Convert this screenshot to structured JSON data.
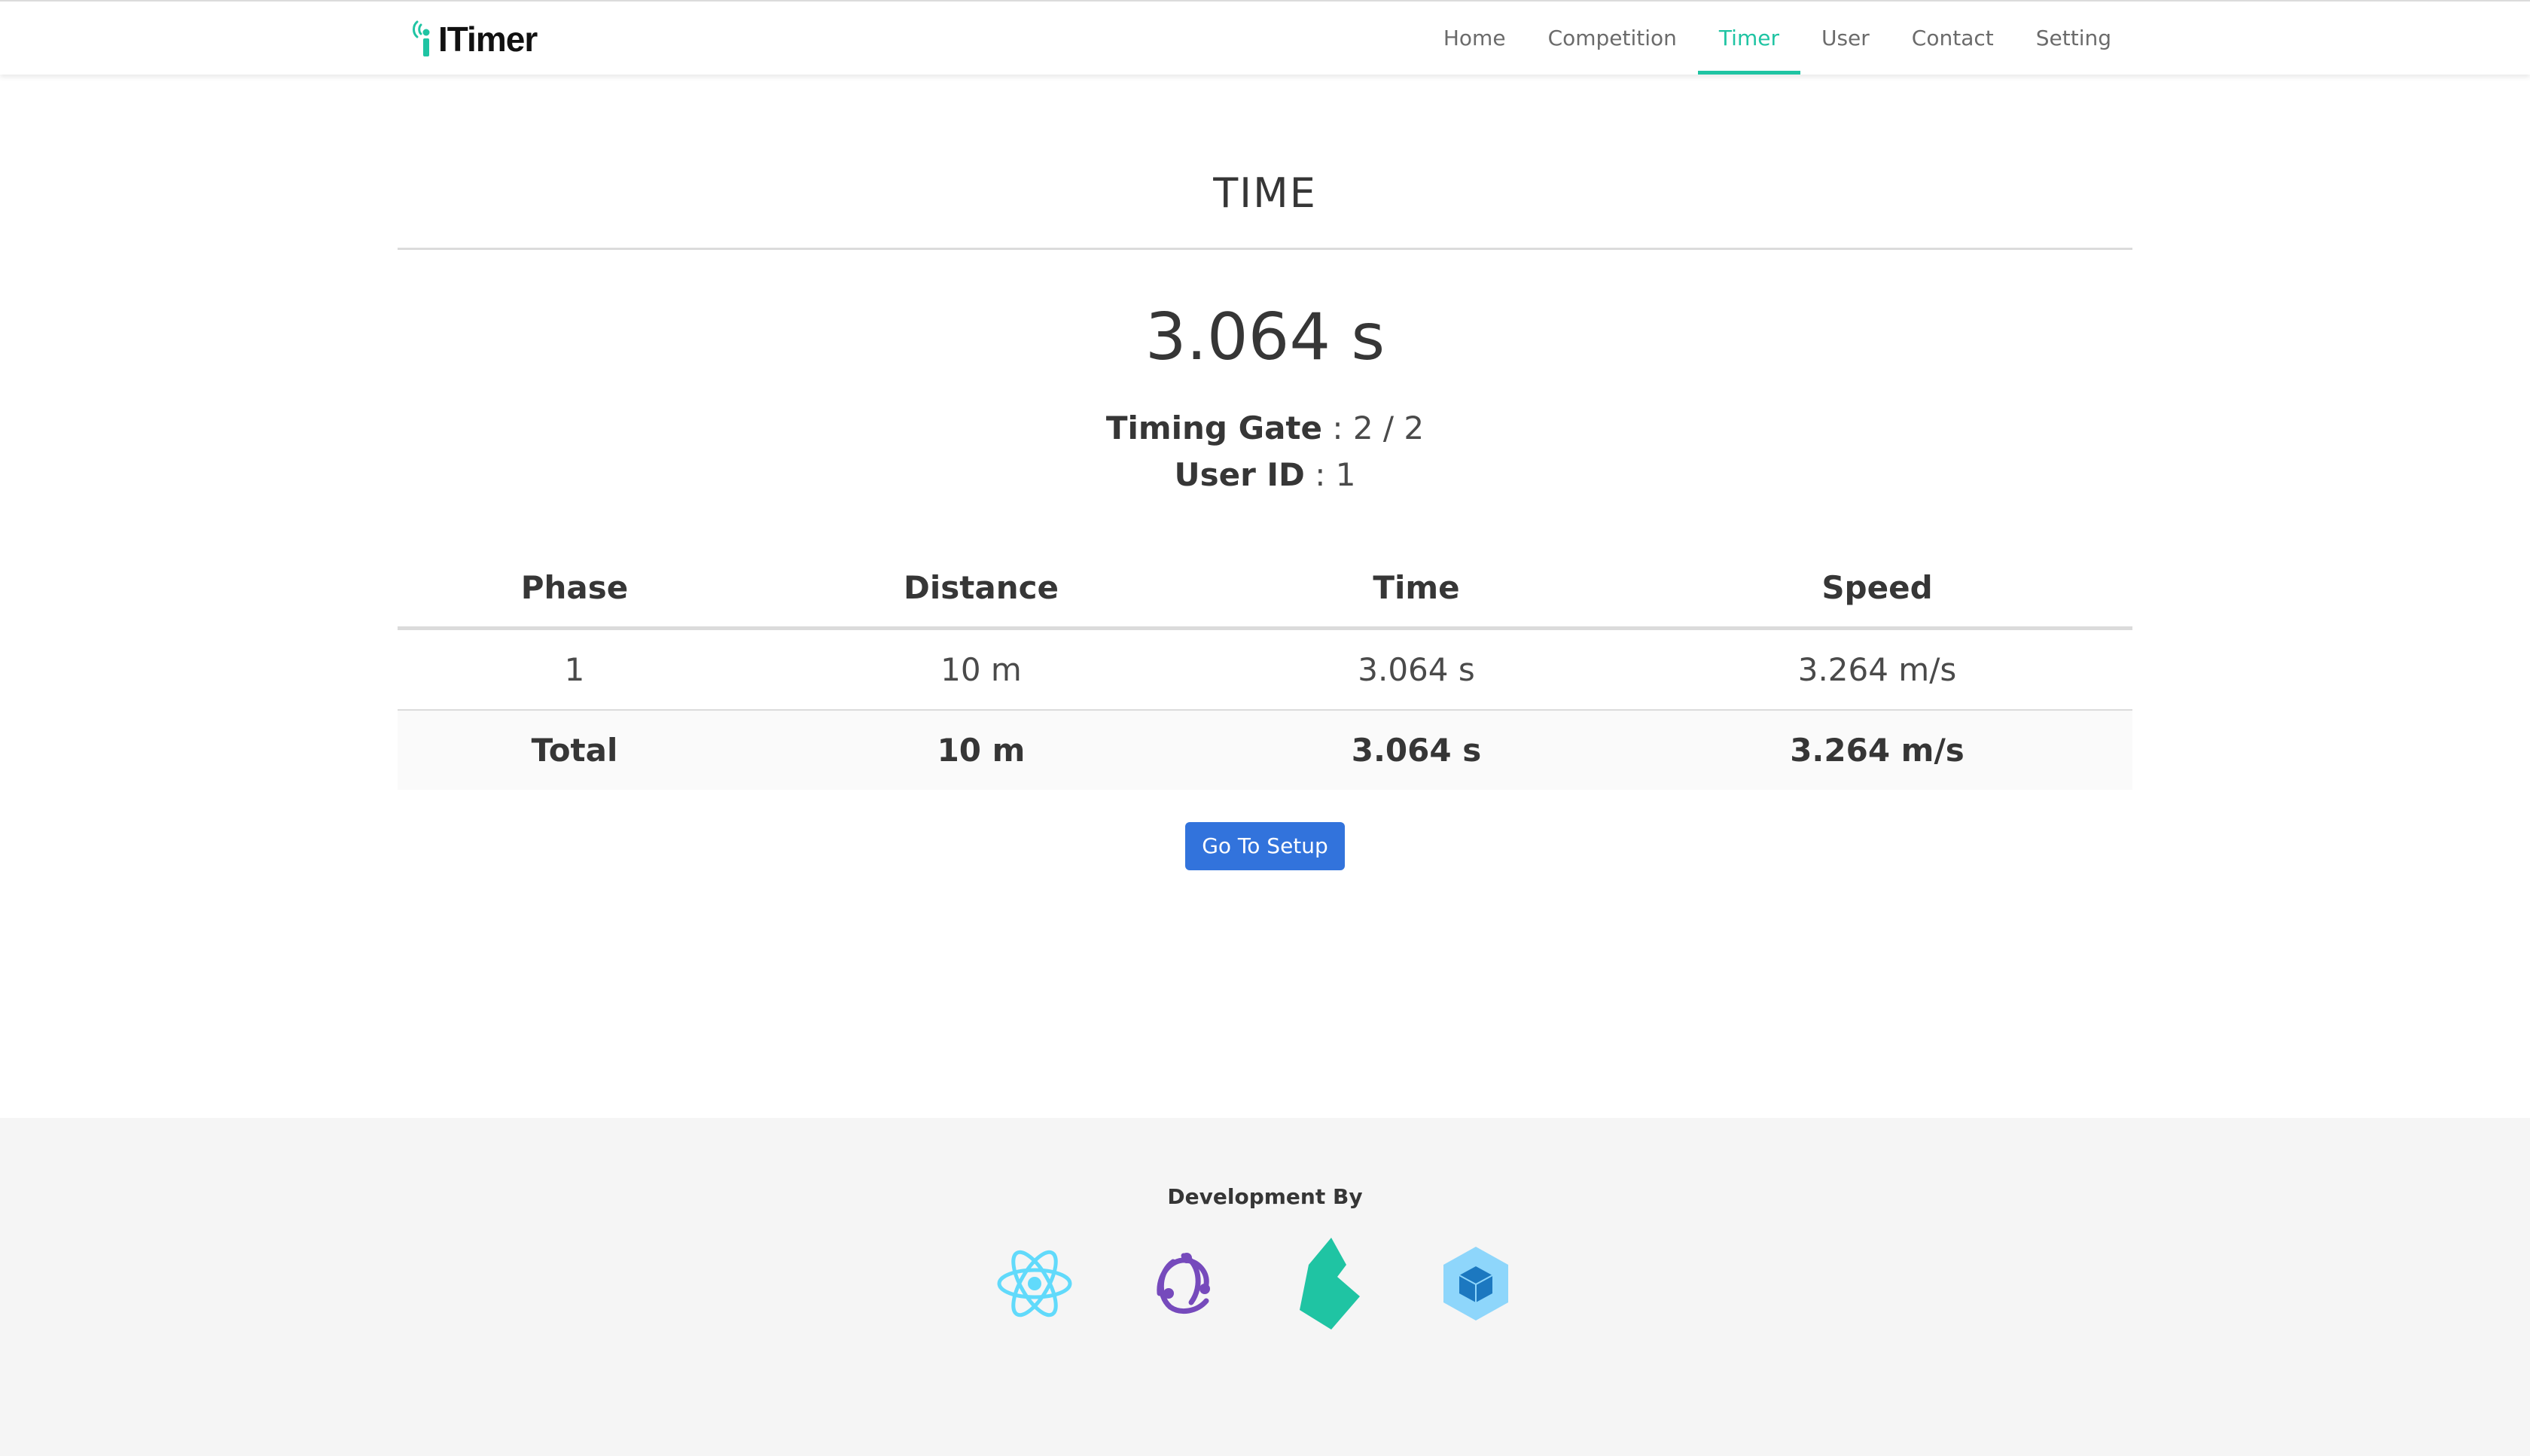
{
  "brand": {
    "name": "ITimer"
  },
  "nav": {
    "items": [
      {
        "label": "Home"
      },
      {
        "label": "Competition"
      },
      {
        "label": "Timer",
        "active": true
      },
      {
        "label": "User"
      },
      {
        "label": "Contact"
      },
      {
        "label": "Setting"
      }
    ],
    "active_color": "#1fc4a3"
  },
  "main": {
    "title": "TIME",
    "time_value": "3.064 s",
    "timing_gate": {
      "label": "Timing Gate",
      "separator": " : ",
      "value": "2 / 2"
    },
    "user_id": {
      "label": "User ID",
      "separator": " : ",
      "value": "1"
    }
  },
  "table": {
    "headers": [
      "Phase",
      "Distance",
      "Time",
      "Speed"
    ],
    "rows": [
      [
        "1",
        "10 m",
        "3.064 s",
        "3.264 m/s"
      ]
    ],
    "total": [
      "Total",
      "10 m",
      "3.064 s",
      "3.264 m/s"
    ]
  },
  "button": {
    "label": "Go To Setup",
    "color": "#3273dc"
  },
  "footer": {
    "title": "Development By",
    "logos": [
      "react-icon",
      "redux-icon",
      "bulma-icon",
      "webpack-icon"
    ]
  }
}
